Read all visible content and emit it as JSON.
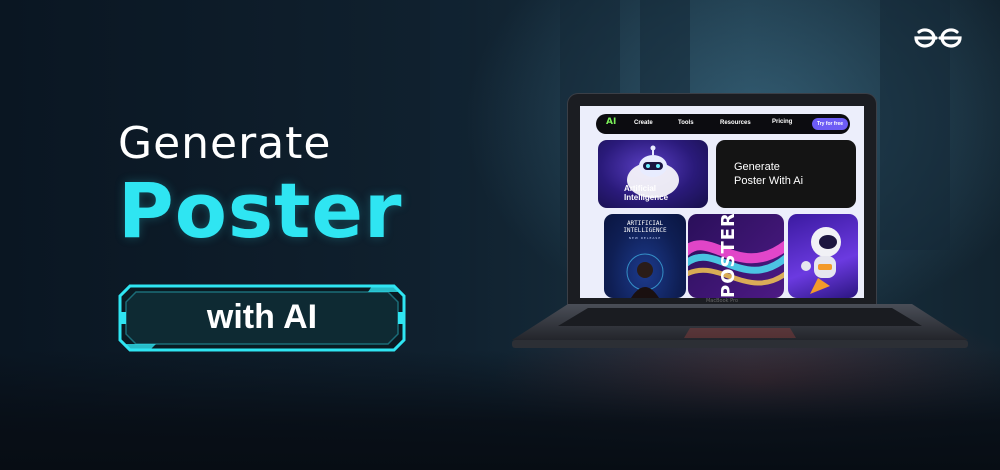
{
  "brand": {
    "logo_icon": "geeksforgeeks-logo-icon"
  },
  "hero": {
    "line1": "Generate",
    "line2": "Poster",
    "badge": "with AI",
    "colors": {
      "line1": "#ffffff",
      "line2": "#2fe5f2",
      "badge_border": "#2fe5f2"
    }
  },
  "laptop": {
    "lid_label": "MacBook Pro",
    "nav": {
      "logo": "AI",
      "items": [
        "Create",
        "Tools",
        "Resources",
        "Pricing"
      ],
      "cta": "Try for free"
    },
    "cards": {
      "ai_card_label": [
        "Artificial",
        "Intelligence"
      ],
      "generate_card_label": [
        "Generate",
        "Poster With Ai"
      ],
      "ai_release_title": [
        "ARTIFICIAL",
        "INTELLIGENCE"
      ],
      "ai_release_sub": "NEW RELEASE",
      "poster_word": "POSTER"
    }
  }
}
